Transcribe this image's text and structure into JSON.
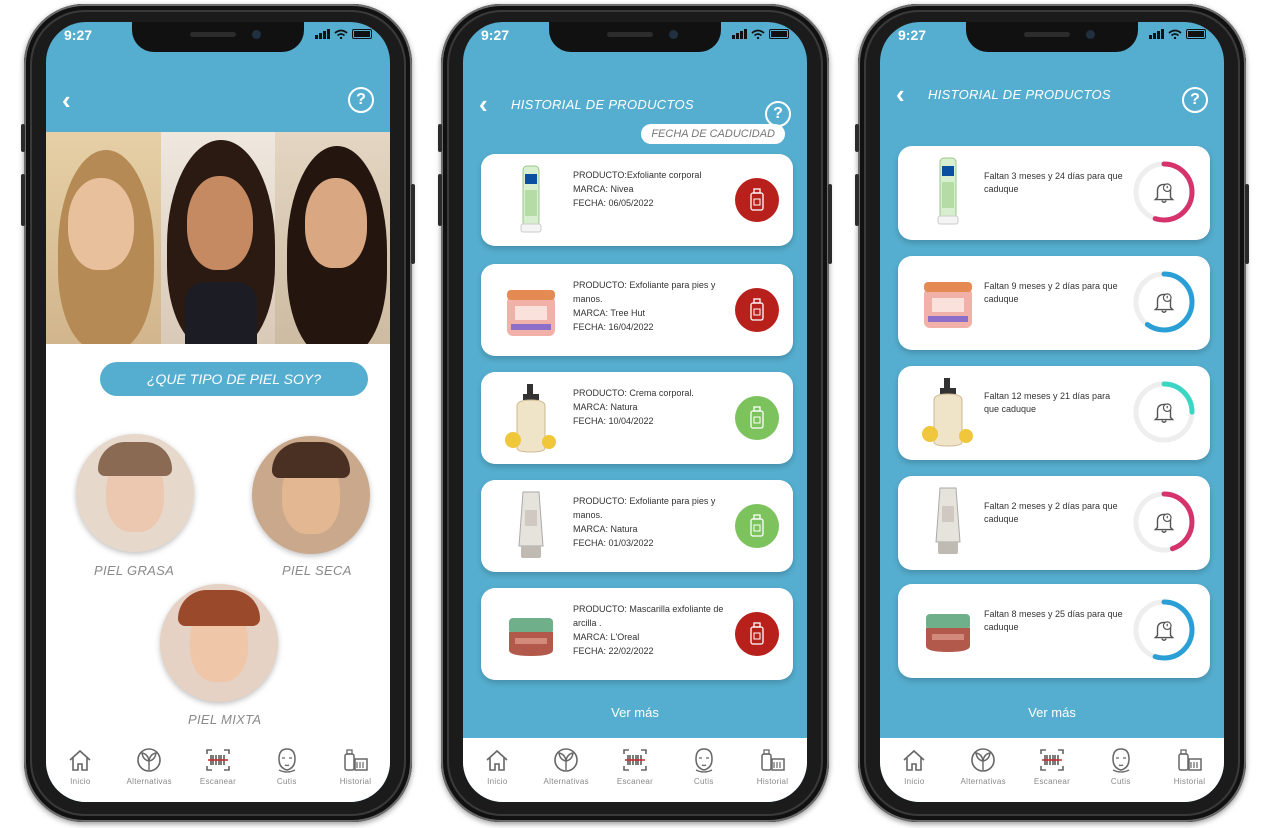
{
  "status_time": "9:27",
  "screen1": {
    "question": "¿QUE TIPO DE PIEL SOY?",
    "skin_types": [
      {
        "label": "PIEL GRASA"
      },
      {
        "label": "PIEL SECA"
      },
      {
        "label": "PIEL MIXTA"
      }
    ]
  },
  "screen2": {
    "title": "HISTORIAL DE PRODUCTOS",
    "filter": "FECHA DE CADUCIDAD",
    "products": [
      {
        "line1": "PRODUCTO:Exfoliante corporal",
        "line2": "MARCA: Nivea",
        "line3": "FECHA: 06/05/2022",
        "status_color": "#b8201c"
      },
      {
        "line1": "PRODUCTO: Exfoliante para pies y manos.",
        "line2": "MARCA: Tree Hut",
        "line3": "FECHA: 16/04/2022",
        "status_color": "#b8201c"
      },
      {
        "line1": "PRODUCTO: Crema corporal.",
        "line2": "MARCA: Natura",
        "line3": "FECHA: 10/04/2022",
        "status_color": "#7cc35e"
      },
      {
        "line1": "PRODUCTO: Exfoliante para pies y manos.",
        "line2": "MARCA: Natura",
        "line3": "FECHA: 01/03/2022",
        "status_color": "#7cc35e"
      },
      {
        "line1": "PRODUCTO: Mascarilla exfoliante de arcilla .",
        "line2": "MARCA: L'Oreal",
        "line3": "FECHA: 22/02/2022",
        "status_color": "#b8201c"
      }
    ],
    "more": "Ver más"
  },
  "screen3": {
    "title": "HISTORIAL DE PRODUCTOS",
    "items": [
      {
        "text": "Faltan 3 meses y 24 días para que caduque",
        "ring_color": "#d6336c",
        "level": 0.55
      },
      {
        "text": "Faltan 9 meses y 2 días para que caduque",
        "ring_color": "#2a9fd6",
        "level": 0.6
      },
      {
        "text": "Faltan 12 meses y 21 días para que caduque",
        "ring_color": "#3ad6c3",
        "level": 0.25
      },
      {
        "text": "Faltan 2 meses y 2 días para que caduque",
        "ring_color": "#d6336c",
        "level": 0.45
      },
      {
        "text": "Faltan 8 meses y 25 días para que caduque",
        "ring_color": "#2a9fd6",
        "level": 0.55
      }
    ],
    "more": "Ver más"
  },
  "nav": [
    {
      "label": "Inicio",
      "icon": "home-icon"
    },
    {
      "label": "Alternativas",
      "icon": "leaf-circle-icon"
    },
    {
      "label": "Escanear",
      "icon": "barcode-scan-icon"
    },
    {
      "label": "Cutis",
      "icon": "face-icon"
    },
    {
      "label": "Historial",
      "icon": "products-history-icon"
    }
  ],
  "colors": {
    "primary": "#55aecf",
    "expired_red": "#b8201c",
    "ok_green": "#7cc35e"
  }
}
